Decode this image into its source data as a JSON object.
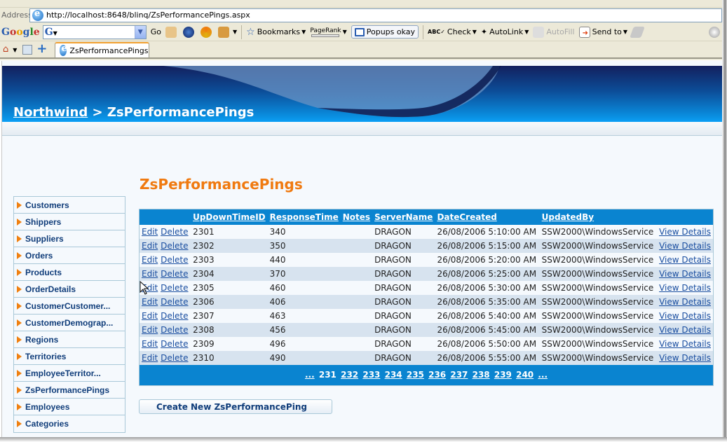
{
  "browser": {
    "address_label": "Address",
    "url": "http://localhost:8648/blinq/ZsPerformancePings.aspx",
    "google_toolbar": {
      "logo": "Google",
      "search_value": "",
      "go_label": "Go",
      "bookmarks_label": "Bookmarks",
      "pagerank_label": "PageRank",
      "popups_label": "Popups okay",
      "check_label": "Check",
      "autolink_label": "AutoLink",
      "autofill_label": "AutoFill",
      "sendto_label": "Send to"
    },
    "tab_title": "ZsPerformancePings"
  },
  "header": {
    "breadcrumb_root": "Northwind",
    "breadcrumb_sep": " > ",
    "breadcrumb_current": "ZsPerformancePings"
  },
  "sidebar": {
    "items": [
      {
        "label": "Customers"
      },
      {
        "label": "Shippers"
      },
      {
        "label": "Suppliers"
      },
      {
        "label": "Orders"
      },
      {
        "label": "Products"
      },
      {
        "label": "OrderDetails"
      },
      {
        "label": "CustomerCustomer..."
      },
      {
        "label": "CustomerDemograp..."
      },
      {
        "label": "Regions"
      },
      {
        "label": "Territories"
      },
      {
        "label": "EmployeeTerritor..."
      },
      {
        "label": "ZsPerformancePings"
      },
      {
        "label": "Employees"
      },
      {
        "label": "Categories"
      }
    ]
  },
  "main": {
    "title": "ZsPerformancePings",
    "columns": [
      "UpDownTimeID",
      "ResponseTime",
      "Notes",
      "ServerName",
      "DateCreated",
      "UpdatedBy"
    ],
    "edit_label": "Edit",
    "delete_label": "Delete",
    "view_label": "View Details",
    "rows": [
      {
        "id": "2301",
        "response": "340",
        "notes": "",
        "server": "DRAGON",
        "date": "26/08/2006 5:10:00 AM",
        "by": "SSW2000\\WindowsService"
      },
      {
        "id": "2302",
        "response": "350",
        "notes": "",
        "server": "DRAGON",
        "date": "26/08/2006 5:15:00 AM",
        "by": "SSW2000\\WindowsService"
      },
      {
        "id": "2303",
        "response": "440",
        "notes": "",
        "server": "DRAGON",
        "date": "26/08/2006 5:20:00 AM",
        "by": "SSW2000\\WindowsService"
      },
      {
        "id": "2304",
        "response": "370",
        "notes": "",
        "server": "DRAGON",
        "date": "26/08/2006 5:25:00 AM",
        "by": "SSW2000\\WindowsService"
      },
      {
        "id": "2305",
        "response": "460",
        "notes": "",
        "server": "DRAGON",
        "date": "26/08/2006 5:30:00 AM",
        "by": "SSW2000\\WindowsService"
      },
      {
        "id": "2306",
        "response": "406",
        "notes": "",
        "server": "DRAGON",
        "date": "26/08/2006 5:35:00 AM",
        "by": "SSW2000\\WindowsService"
      },
      {
        "id": "2307",
        "response": "463",
        "notes": "",
        "server": "DRAGON",
        "date": "26/08/2006 5:40:00 AM",
        "by": "SSW2000\\WindowsService"
      },
      {
        "id": "2308",
        "response": "456",
        "notes": "",
        "server": "DRAGON",
        "date": "26/08/2006 5:45:00 AM",
        "by": "SSW2000\\WindowsService"
      },
      {
        "id": "2309",
        "response": "496",
        "notes": "",
        "server": "DRAGON",
        "date": "26/08/2006 5:50:00 AM",
        "by": "SSW2000\\WindowsService"
      },
      {
        "id": "2310",
        "response": "490",
        "notes": "",
        "server": "DRAGON",
        "date": "26/08/2006 5:55:00 AM",
        "by": "SSW2000\\WindowsService"
      }
    ],
    "pager": {
      "prev": "...",
      "current": "231",
      "pages": [
        "232",
        "233",
        "234",
        "235",
        "236",
        "237",
        "238",
        "239",
        "240"
      ],
      "next": "..."
    },
    "create_label": "Create New ZsPerformancePing"
  },
  "colors": {
    "accent_orange": "#f07a10",
    "grid_header_blue": "#0a84d0",
    "nav_text": "#103d7a"
  }
}
